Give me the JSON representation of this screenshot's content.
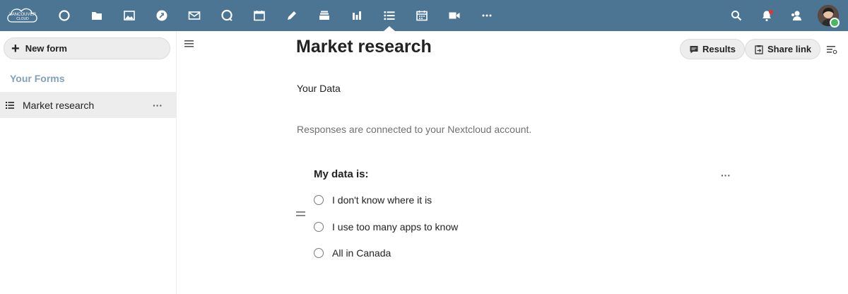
{
  "app": {
    "logo_text_line1": "VANCOUVER",
    "logo_text_line2": "CLOUD",
    "nav_icons": [
      "dashboard-icon",
      "files-icon",
      "photos-icon",
      "activity-icon",
      "mail-icon",
      "talk-icon",
      "calendar-icon",
      "notes-icon",
      "deck-icon",
      "analytics-icon",
      "forms-icon",
      "tasks-icon",
      "video-icon",
      "more-apps-icon"
    ],
    "header_right_icons": [
      "search-icon",
      "notifications-icon",
      "contacts-icon"
    ],
    "header_color": "#4c7593"
  },
  "sidebar": {
    "new_form_label": "New form",
    "section_caption": "Your Forms",
    "forms": [
      {
        "label": "Market research",
        "more": "···"
      }
    ]
  },
  "main": {
    "title": "Market research",
    "results_label": "Results",
    "share_label": "Share link",
    "description": "Your Data",
    "helper_text": "Responses are connected to your Nextcloud account.",
    "question": {
      "title": "My data is:",
      "more": "···",
      "options": [
        "I don't know where it is",
        "I use too many apps to know",
        "All in Canada"
      ]
    }
  }
}
